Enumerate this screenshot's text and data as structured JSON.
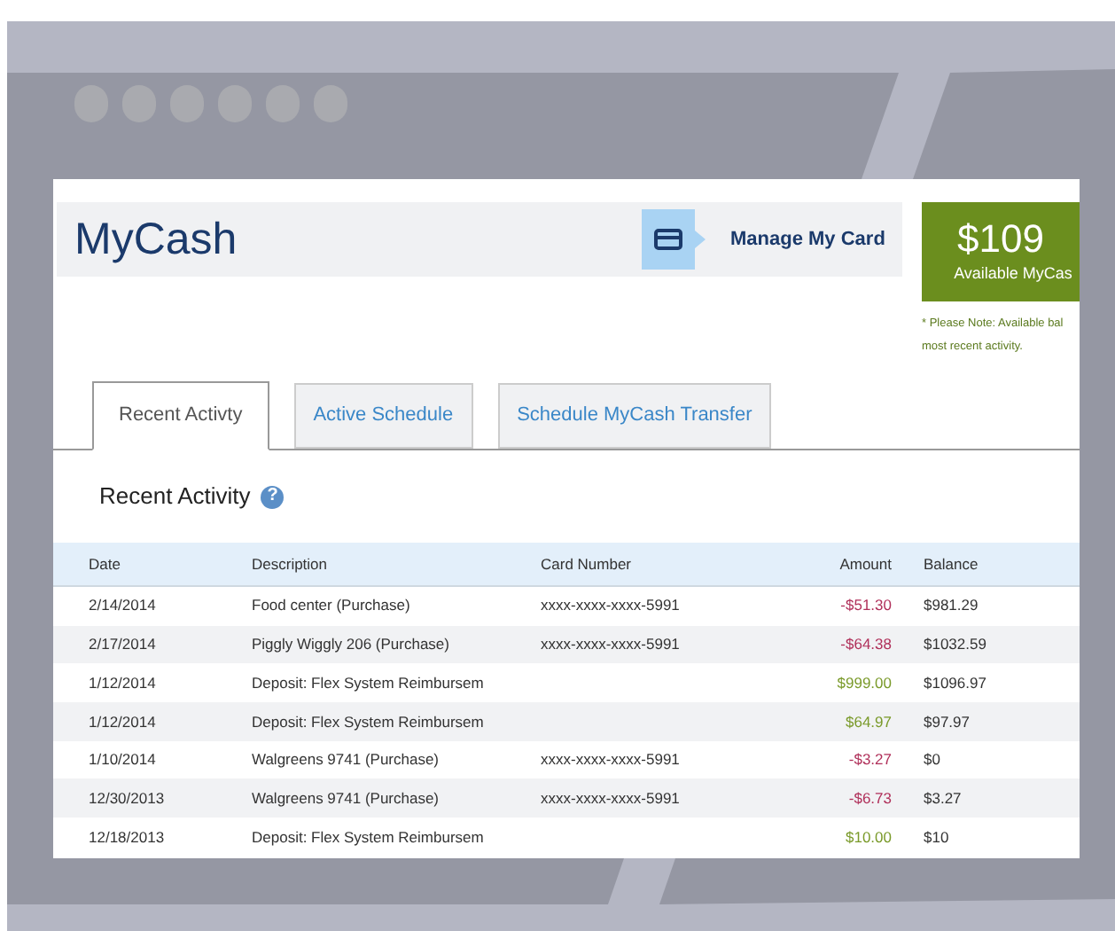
{
  "page": {
    "title": "MyCash",
    "manage_card": "Manage My Card"
  },
  "balance": {
    "amount": "$109",
    "label": "Available MyCas",
    "note_lines": [
      "* Please Note: Available bal",
      "most recent activity."
    ]
  },
  "tabs": [
    {
      "label": "Recent Activty",
      "selected": true
    },
    {
      "label": "Active Schedule",
      "selected": false
    },
    {
      "label": "Schedule MyCash Transfer",
      "selected": false
    }
  ],
  "section": {
    "title": "Recent Activity",
    "help_icon": "?"
  },
  "table": {
    "columns": [
      "Date",
      "Description",
      "Card Number",
      "Amount",
      "Balance"
    ],
    "rows": [
      {
        "date": "2/14/2014",
        "description": "Food center (Purchase)",
        "card": "xxxx-xxxx-xxxx-5991",
        "amount": "-$51.30",
        "kind": "debit",
        "balance": "$981.29"
      },
      {
        "date": "2/17/2014",
        "description": "Piggly Wiggly 206 (Purchase)",
        "card": "xxxx-xxxx-xxxx-5991",
        "amount": "-$64.38",
        "kind": "debit",
        "balance": "$1032.59"
      },
      {
        "date": "1/12/2014",
        "description": "Deposit: Flex System Reimbursem",
        "amount": "$999.00",
        "kind": "credit",
        "balance": "$1096.97"
      },
      {
        "date": "1/12/2014",
        "description": "Deposit: Flex System Reimbursem",
        "amount": "$64.97",
        "kind": "credit",
        "balance": "$97.97"
      },
      {
        "date": "1/10/2014",
        "description": "Walgreens 9741 (Purchase)",
        "card": "xxxx-xxxx-xxxx-5991",
        "amount": "-$3.27",
        "kind": "debit",
        "balance": "$0"
      },
      {
        "date": "12/30/2013",
        "description": "Walgreens 9741 (Purchase)",
        "card": "xxxx-xxxx-xxxx-5991",
        "amount": "-$6.73",
        "kind": "debit",
        "balance": "$3.27"
      },
      {
        "date": "12/18/2013",
        "description": "Deposit: Flex System Reimbursem",
        "amount": "$10.00",
        "kind": "credit",
        "balance": "$10"
      }
    ]
  }
}
